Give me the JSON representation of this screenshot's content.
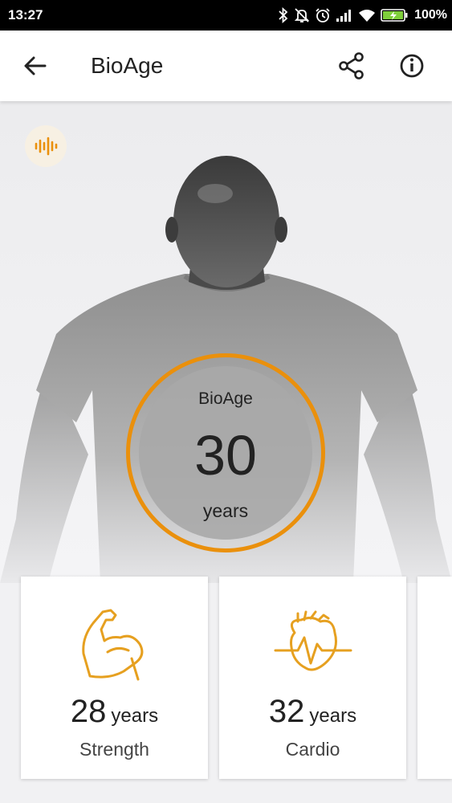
{
  "status_bar": {
    "time": "13:27",
    "battery_percent": "100%",
    "icons": [
      "bluetooth-icon",
      "notifications-off-icon",
      "alarm-icon",
      "signal-icon",
      "wifi-icon",
      "battery-charging-icon"
    ]
  },
  "app_bar": {
    "title": "BioAge",
    "icons": [
      "back-arrow-icon",
      "share-icon",
      "info-icon"
    ]
  },
  "hero": {
    "badge_icon": "soundwave-icon",
    "ring_label": "BioAge",
    "ring_value": "30",
    "ring_unit": "years"
  },
  "cards": [
    {
      "icon": "flexed-arm-icon",
      "value": "28",
      "unit": "years",
      "label": "Strength"
    },
    {
      "icon": "heart-pulse-icon",
      "value": "32",
      "unit": "years",
      "label": "Cardio"
    }
  ],
  "colors": {
    "accent": "#ea900c",
    "status_bar_bg": "#000000",
    "app_bar_bg": "#ffffff",
    "card_bg": "#ffffff"
  }
}
